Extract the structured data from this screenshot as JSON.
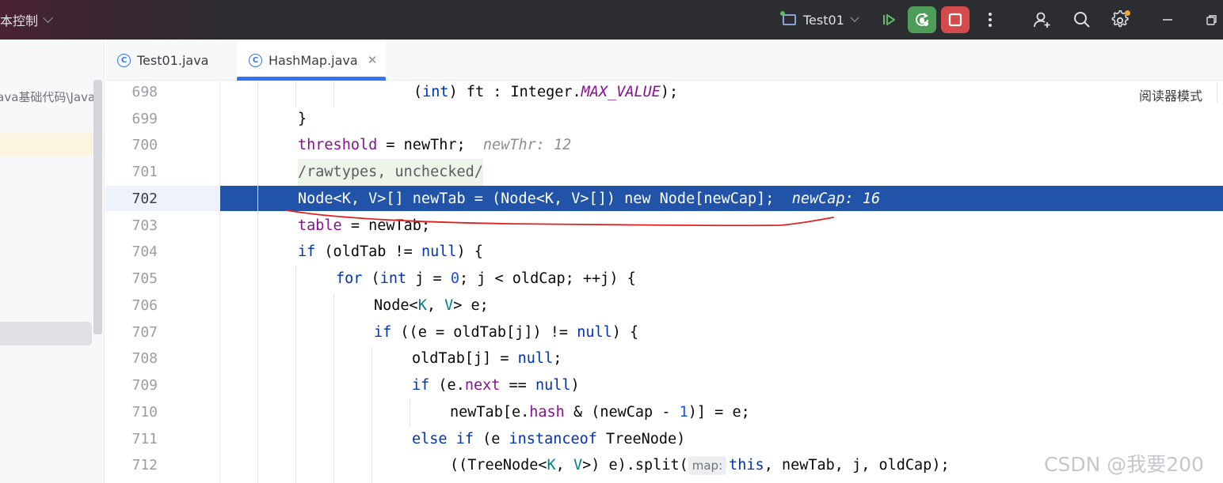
{
  "titlebar": {
    "vcs_label": "本控制",
    "run_config": "Test01"
  },
  "left_panel": {
    "path": "java基础代码\\Java"
  },
  "tabs": [
    {
      "label": "Test01.java",
      "icon": "class-icon",
      "active": false
    },
    {
      "label": "HashMap.java",
      "icon": "class-icon",
      "active": true,
      "close": "✕"
    }
  ],
  "editor": {
    "reader_mode": "阅读器模式",
    "current_line": "702",
    "lines": [
      {
        "num": "698",
        "code_a": "(",
        "code_b": "int",
        "code_c": ") ft : Integer.",
        "code_d": "MAX_VALUE",
        "code_e": ");"
      },
      {
        "num": "699",
        "code": "}"
      },
      {
        "num": "700",
        "code_a": "threshold",
        "code_b": " = newThr;",
        "hint": "newThr: 12"
      },
      {
        "num": "701",
        "code": "/rawtypes, unchecked/"
      },
      {
        "num": "702",
        "code": "Node<K, V>[] newTab = (Node<K, V>[]) new Node[newCap];",
        "hint": "newCap: 16"
      },
      {
        "num": "703",
        "code_a": "table",
        "code_b": " = newTab;"
      },
      {
        "num": "704",
        "code_a": "if",
        "code_b": " (oldTab != ",
        "code_c": "null",
        "code_d": ") {"
      },
      {
        "num": "705",
        "code_a": "for",
        "code_b": " (",
        "code_c": "int",
        "code_d": " j = ",
        "code_e": "0",
        "code_f": "; j < oldCap; ++j) {"
      },
      {
        "num": "706",
        "code_a": "Node<",
        "code_b": "K",
        "code_c": ", ",
        "code_d": "V",
        "code_e": "> e;"
      },
      {
        "num": "707",
        "code_a": "if",
        "code_b": " ((e = oldTab[j]) != ",
        "code_c": "null",
        "code_d": ") {"
      },
      {
        "num": "708",
        "code_a": "oldTab[j] = ",
        "code_b": "null",
        "code_c": ";"
      },
      {
        "num": "709",
        "code_a": "if",
        "code_b": " (e.",
        "code_c": "next",
        "code_d": " == ",
        "code_e": "null",
        "code_f": ")"
      },
      {
        "num": "710",
        "code_a": "newTab[e.",
        "code_b": "hash",
        "code_c": " & (newCap - ",
        "code_d": "1",
        "code_e": ")] = e;"
      },
      {
        "num": "711",
        "code_a": "else if",
        "code_b": " (e ",
        "code_c": "instanceof",
        "code_d": " TreeNode)"
      },
      {
        "num": "712",
        "code_a": "((TreeNode<",
        "code_b": "K",
        "code_c": ", ",
        "code_d": "V",
        "code_e": ">) e).split(",
        "param_hint": "map:",
        "code_f": "this",
        "code_g": ", newTab, j, oldCap);"
      }
    ]
  },
  "watermark": "CSDN @我要200",
  "colors": {
    "accent": "#3574f0",
    "debug_green": "#4d9c58",
    "stop_red": "#d34b4b",
    "execution_line": "#2154a8",
    "annotation_red": "#e02020"
  }
}
